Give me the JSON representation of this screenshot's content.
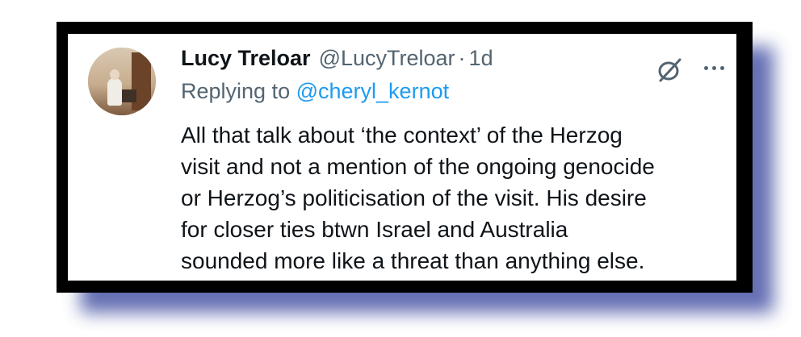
{
  "tweet": {
    "display_name": "Lucy Treloar",
    "handle": "@LucyTreloar",
    "separator": "·",
    "time": "1d",
    "replying_prefix": "Replying to",
    "replying_to": "@cheryl_kernot",
    "text_lines": [
      "All that talk about ‘the context’ of the Herzog",
      "visit and not a mention of the ongoing genocide",
      "or Herzog’s politicisation of the visit. His desire",
      "for closer ties btwn Israel and Australia",
      "sounded more like a threat than anything else."
    ]
  },
  "icons": {
    "grok": "grok-icon",
    "more": "more-icon",
    "avatar": "avatar"
  },
  "colors": {
    "text_primary": "#0f1419",
    "text_secondary": "#536471",
    "link": "#1d9bf0",
    "frame": "#000000",
    "shadow": "#4a56a6"
  }
}
